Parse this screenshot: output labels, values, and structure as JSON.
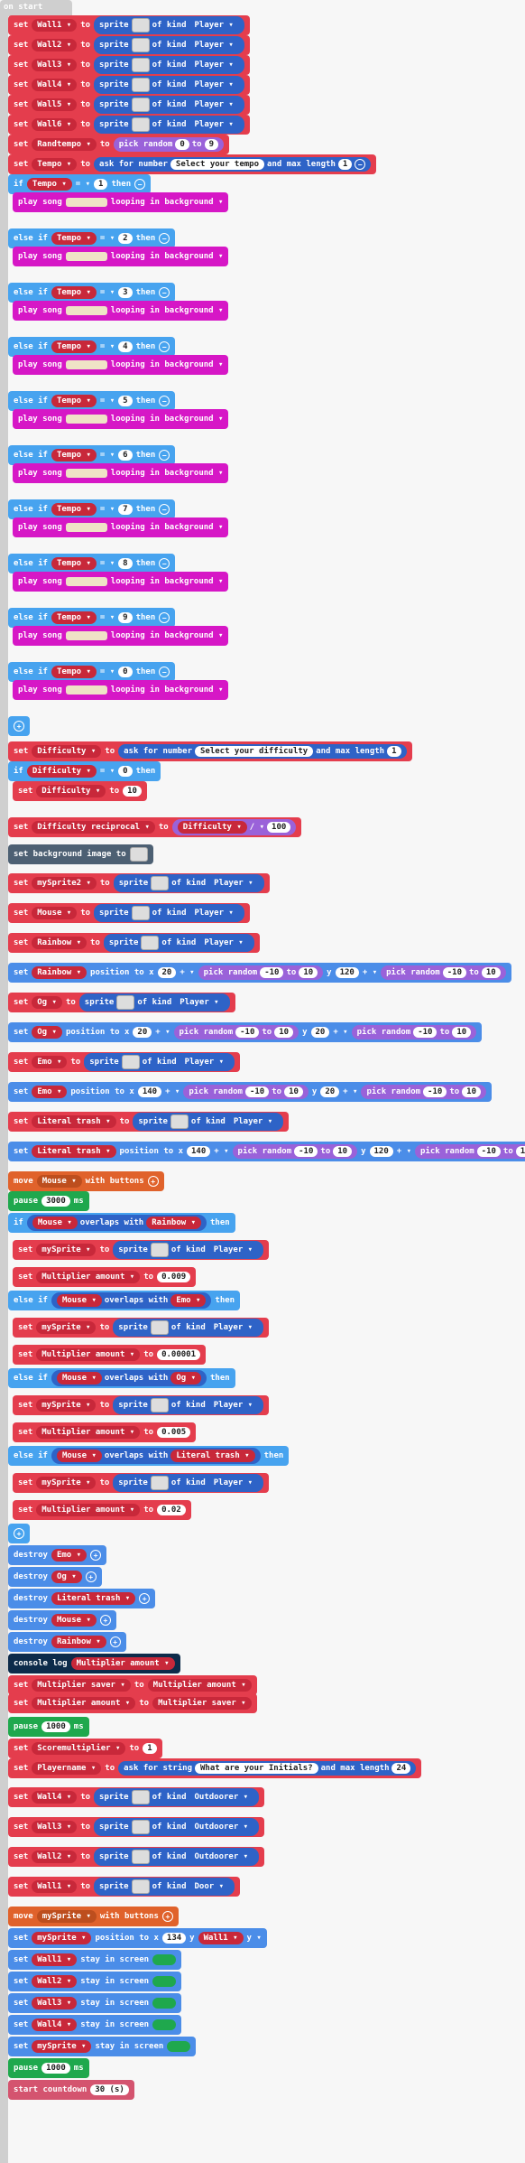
{
  "hat": "on start",
  "labels": {
    "set": "set",
    "to": "to",
    "sprite": "sprite",
    "of_kind": "of kind",
    "if": "if",
    "else_if": "else if",
    "then": "then",
    "play_song": "play song",
    "looping": "looping in background",
    "pick_random": "pick random",
    "ask_number": "ask for number",
    "max_length": "and max length",
    "destroy": "destroy",
    "pause": "pause",
    "ms": "ms",
    "move": "move",
    "with_buttons": "with buttons",
    "console_log": "console log",
    "stay": "stay in screen",
    "overlaps": "overlaps with",
    "position": "position to x",
    "start_countdown": "start countdown",
    "ask_string": "ask for string",
    "set_bg": "set background image to",
    "on": "ON"
  },
  "walls": [
    "Wall1",
    "Wall2",
    "Wall3",
    "Wall4",
    "Wall5",
    "Wall6"
  ],
  "kind": "Player",
  "tempo_vals": [
    "1",
    "2",
    "3",
    "4",
    "5",
    "6",
    "7",
    "8",
    "9",
    "0"
  ],
  "v": {
    "randtempo": "Randtempo",
    "tempo": "Tempo",
    "diff": "Difficulty",
    "diffr": "Difficulty reciprocal",
    "mysprite2": "mySprite2",
    "mouse": "Mouse",
    "rainbow": "Rainbow",
    "og": "Og",
    "emo": "Emo",
    "lit": "Literal trash",
    "mysprite": "mySprite",
    "mult": "Multiplier amount",
    "saver": "Multiplier saver",
    "score": "Scoremultiplier",
    "player": "Playername",
    "outdoor": "Outdoorer",
    "door": "Door"
  },
  "s": {
    "select_tempo": "Select your tempo",
    "select_diff": "Select your difficulty",
    "initials": "What are your Initials?",
    "n0": "0",
    "n9": "9",
    "n1": "1",
    "n10": "10",
    "n100": "100",
    "n3000": "3000",
    "n1000": "1000",
    "n30": "30 (s)",
    "n24": "24",
    "n134": "134",
    "m0": "0.009",
    "m1": "0.00001",
    "m2": "0.005",
    "m3": "0.02",
    "n20": "20",
    "n120": "120",
    "n140": "140",
    "neg": "-10"
  }
}
